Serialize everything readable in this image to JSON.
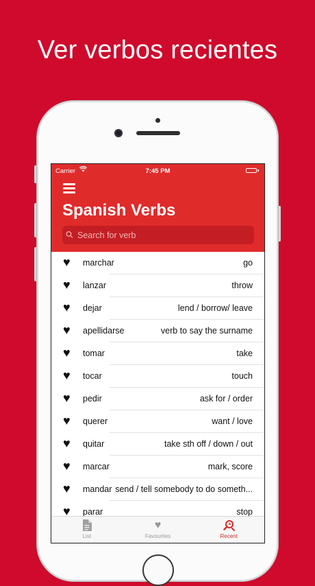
{
  "headline": "Ver verbos recientes",
  "status_bar": {
    "carrier": "Carrier",
    "time": "7:45 PM"
  },
  "app": {
    "title": "Spanish Verbs",
    "search_placeholder": "Search for verb"
  },
  "verbs": [
    {
      "verb": "marchar",
      "meaning": "go"
    },
    {
      "verb": "lanzar",
      "meaning": "throw"
    },
    {
      "verb": "dejar",
      "meaning": "lend / borrow/ leave"
    },
    {
      "verb": "apellidarse",
      "meaning": "verb to say the surname"
    },
    {
      "verb": "tomar",
      "meaning": "take"
    },
    {
      "verb": "tocar",
      "meaning": "touch"
    },
    {
      "verb": "pedir",
      "meaning": "ask for / order"
    },
    {
      "verb": "querer",
      "meaning": "want / love"
    },
    {
      "verb": "quitar",
      "meaning": "take sth off / down / out"
    },
    {
      "verb": "marcar",
      "meaning": "mark, score"
    },
    {
      "verb": "mandar",
      "meaning": "send / tell somebody to do someth..."
    },
    {
      "verb": "parar",
      "meaning": "stop"
    }
  ],
  "tabs": [
    {
      "label": "List",
      "icon": "document-icon"
    },
    {
      "label": "Favourites",
      "icon": "heart-icon"
    },
    {
      "label": "Recent",
      "icon": "recent-search-icon",
      "active": true
    }
  ],
  "colors": {
    "background": "#cf0a2c",
    "header": "#e02b2b",
    "accent": "#d92a2a"
  }
}
